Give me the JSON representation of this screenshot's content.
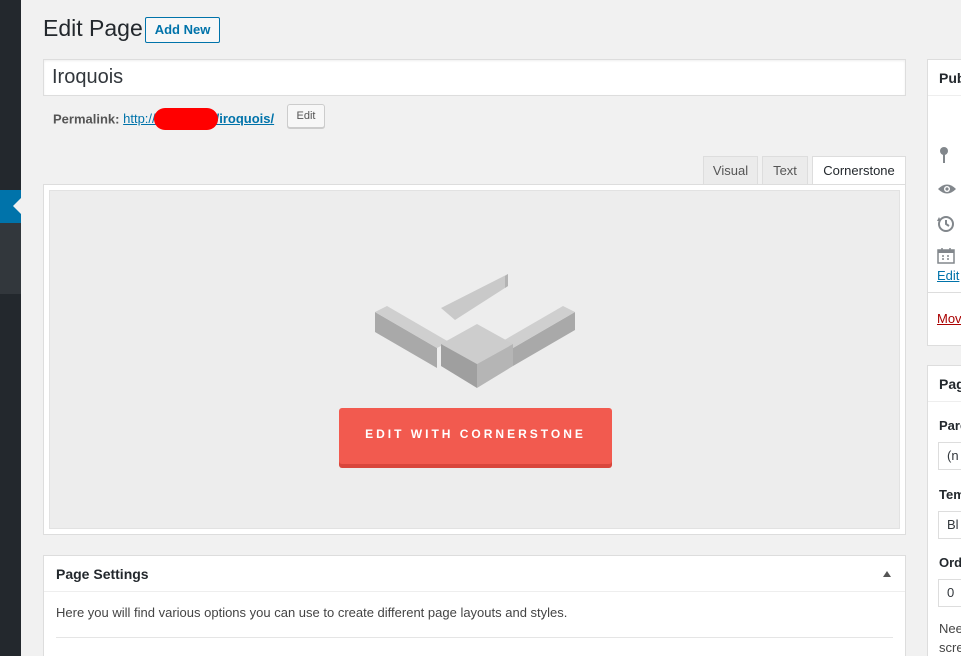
{
  "header": {
    "title": "Edit Page",
    "add_new_label": "Add New"
  },
  "post": {
    "title": "Iroquois",
    "permalink_label": "Permalink:",
    "permalink_prefix": "http://",
    "permalink_slug": "/iroquois/",
    "edit_slug_label": "Edit"
  },
  "editor": {
    "tabs": [
      {
        "label": "Visual",
        "active": false
      },
      {
        "label": "Text",
        "active": false
      },
      {
        "label": "Cornerstone",
        "active": true
      }
    ],
    "cornerstone_button_label": "EDIT WITH CORNERSTONE"
  },
  "page_settings": {
    "title": "Page Settings",
    "description": "Here you will find various options you can use to create different page layouts and styles."
  },
  "publish_box": {
    "title": "Pub",
    "edit_label": "Edit",
    "move_label": "Mov"
  },
  "attributes_box": {
    "title": "Pag",
    "parent_label": "Pare",
    "parent_value": "(n",
    "template_label": "Tem",
    "template_value": "Bl",
    "order_label": "Ord",
    "order_value": "0",
    "help_line1": "Nee",
    "help_line2": "scre"
  },
  "colors": {
    "accent": "#0073aa",
    "cornerstone_button": "#f25a4f",
    "redaction": "#ff0000"
  }
}
